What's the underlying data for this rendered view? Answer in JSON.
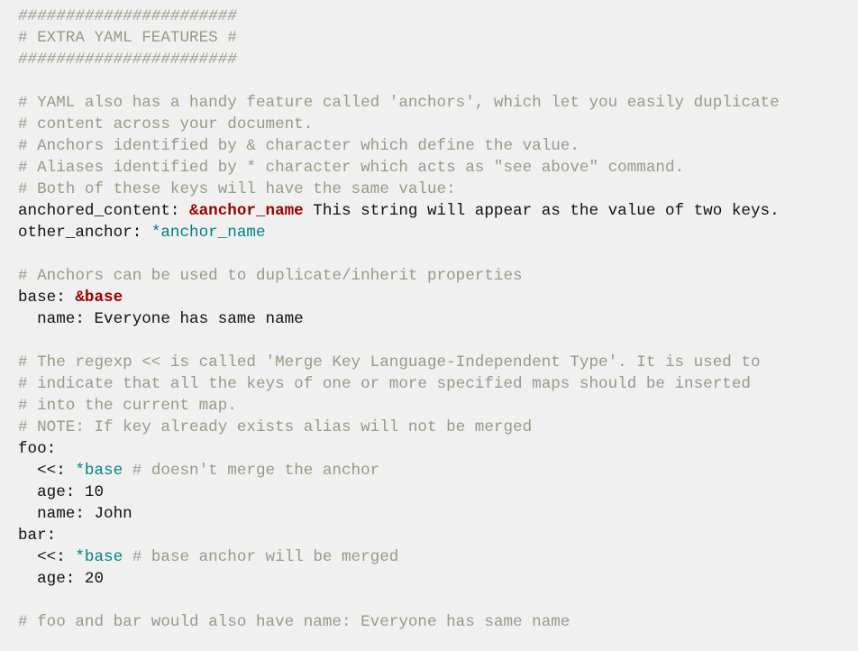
{
  "colors": {
    "background": "#f0f0f0",
    "text": "#111111",
    "comment": "#999988",
    "anchor": "#990000",
    "alias": "#008080"
  },
  "lines": [
    {
      "type": "comment-hashes",
      "comment": "#######################"
    },
    {
      "type": "comment",
      "comment": "# EXTRA YAML FEATURES #"
    },
    {
      "type": "comment-hashes",
      "comment": "#######################"
    },
    {
      "type": "blank"
    },
    {
      "type": "comment",
      "comment": "# YAML also has a handy feature called 'anchors', which let you easily duplicate"
    },
    {
      "type": "comment",
      "comment": "# content across your document."
    },
    {
      "type": "comment",
      "comment": "# Anchors identified by & character which define the value."
    },
    {
      "type": "comment",
      "comment": "# Aliases identified by * character which acts as \"see above\" command."
    },
    {
      "type": "comment",
      "comment": "# Both of these keys will have the same value:"
    },
    {
      "type": "key-anchor-value",
      "key": "anchored_content: ",
      "anchor": "&anchor_name",
      "value": " This string will appear as the value of two keys."
    },
    {
      "type": "key-alias",
      "key": "other_anchor: ",
      "alias": "*anchor_name"
    },
    {
      "type": "blank"
    },
    {
      "type": "comment",
      "comment": "# Anchors can be used to duplicate/inherit properties"
    },
    {
      "type": "key-anchor",
      "key": "base: ",
      "anchor": "&base"
    },
    {
      "type": "plain",
      "text": "  name: Everyone has same name"
    },
    {
      "type": "blank"
    },
    {
      "type": "comment",
      "comment": "# The regexp << is called 'Merge Key Language-Independent Type'. It is used to"
    },
    {
      "type": "comment",
      "comment": "# indicate that all the keys of one or more specified maps should be inserted"
    },
    {
      "type": "comment",
      "comment": "# into the current map."
    },
    {
      "type": "comment",
      "comment": "# NOTE: If key already exists alias will not be merged"
    },
    {
      "type": "plain",
      "text": "foo:"
    },
    {
      "type": "key-alias-comment",
      "key": "  <<: ",
      "alias": "*base",
      "comment": " # doesn't merge the anchor"
    },
    {
      "type": "plain",
      "text": "  age: 10"
    },
    {
      "type": "plain",
      "text": "  name: John"
    },
    {
      "type": "plain",
      "text": "bar:"
    },
    {
      "type": "key-alias-comment",
      "key": "  <<: ",
      "alias": "*base",
      "comment": " # base anchor will be merged"
    },
    {
      "type": "plain",
      "text": "  age: 20"
    },
    {
      "type": "blank"
    },
    {
      "type": "comment",
      "comment": "# foo and bar would also have name: Everyone has same name"
    }
  ]
}
